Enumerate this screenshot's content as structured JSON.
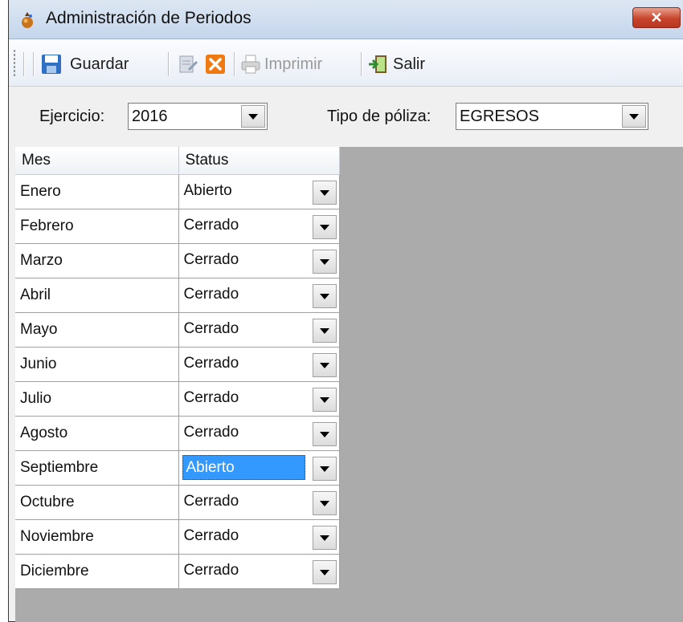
{
  "window": {
    "title": "Administración de Periodos",
    "close_symbol": "✕"
  },
  "toolbar": {
    "save_label": "Guardar",
    "print_label": "Imprimir",
    "exit_label": "Salir"
  },
  "filters": {
    "ejercicio_label": "Ejercicio:",
    "ejercicio_value": "2016",
    "tipo_label": "Tipo de póliza:",
    "tipo_value": "EGRESOS"
  },
  "grid": {
    "columns": [
      "Mes",
      "Status"
    ],
    "rows": [
      {
        "mes": "Enero",
        "status": "Abierto"
      },
      {
        "mes": "Febrero",
        "status": "Cerrado"
      },
      {
        "mes": "Marzo",
        "status": "Cerrado"
      },
      {
        "mes": "Abril",
        "status": "Cerrado"
      },
      {
        "mes": "Mayo",
        "status": "Cerrado"
      },
      {
        "mes": "Junio",
        "status": "Cerrado"
      },
      {
        "mes": "Julio",
        "status": "Cerrado"
      },
      {
        "mes": "Agosto",
        "status": "Cerrado"
      },
      {
        "mes": "Septiembre",
        "status": "Abierto"
      },
      {
        "mes": "Octubre",
        "status": "Cerrado"
      },
      {
        "mes": "Noviembre",
        "status": "Cerrado"
      },
      {
        "mes": "Diciembre",
        "status": "Cerrado"
      }
    ]
  },
  "colors": {
    "selection": "#3399ff",
    "grid_background": "#ababab",
    "close_button": "#c8442c"
  }
}
